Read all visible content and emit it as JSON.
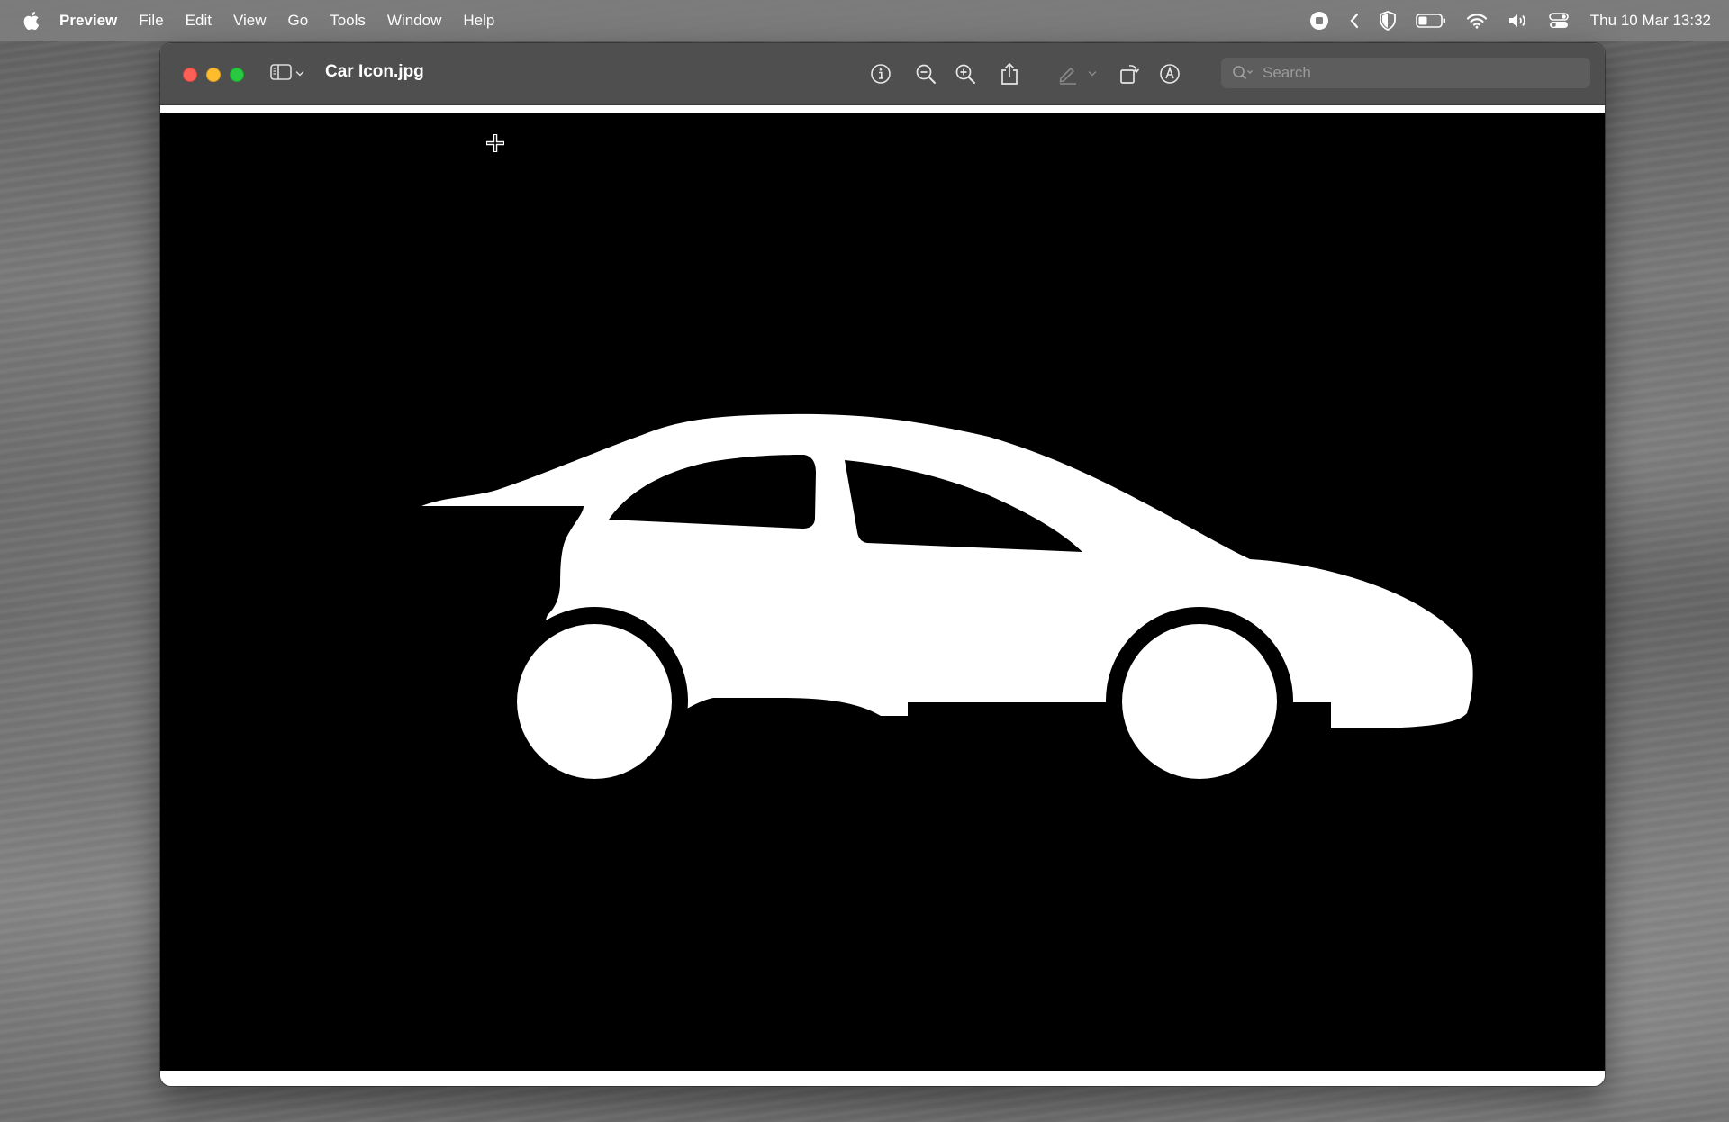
{
  "menubar": {
    "app_name": "Preview",
    "items": [
      "File",
      "Edit",
      "View",
      "Go",
      "Tools",
      "Window",
      "Help"
    ],
    "clock": "Thu 10 Mar  13:32",
    "status_icons": [
      "screen-record-icon",
      "chevron-left-icon",
      "shield-icon",
      "battery-icon",
      "wifi-icon",
      "volume-icon",
      "control-center-icon"
    ]
  },
  "window": {
    "title": "Car Icon.jpg",
    "toolbar_icons": [
      "info-icon",
      "zoom-out-icon",
      "zoom-in-icon",
      "share-icon",
      "highlight-icon",
      "highlight-options-chevron-icon",
      "rotate-icon",
      "markup-icon"
    ],
    "search": {
      "placeholder": "Search",
      "value": ""
    }
  },
  "document": {
    "image_subject": "car-silhouette-icon",
    "background_color": "#000000",
    "foreground_color": "#ffffff"
  },
  "colors": {
    "traffic_close": "#fe5f57",
    "traffic_minimize": "#febc2e",
    "traffic_zoom": "#28c840",
    "titlebar": "#4f4f4f"
  }
}
